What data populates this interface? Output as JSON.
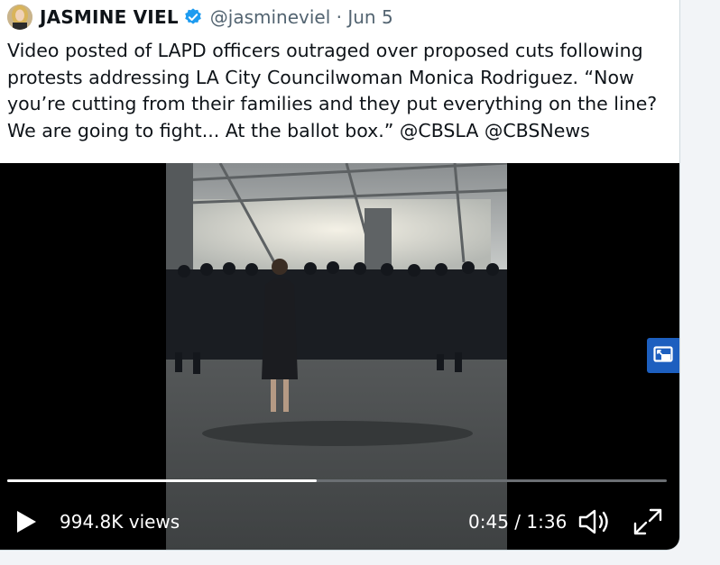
{
  "tweet": {
    "author_name": "JASMINE VIEL",
    "handle": "@jasmineviel",
    "separator": "·",
    "date": "Jun 5",
    "text": "Video posted of LAPD officers outraged over proposed cuts following protests addressing LA City Councilwoman Monica Rodriguez. “Now you’re cutting from their families and they put everything on the line? We are going to fight... At the ballot box.” @CBSLA @CBSNews"
  },
  "video": {
    "views": "994.8K views",
    "current_time": "0:45",
    "time_separator": "/",
    "duration": "1:36",
    "progress": 0.469
  },
  "icons": {
    "verified": "verified-badge-icon",
    "play": "play-icon",
    "volume": "volume-icon",
    "fullscreen": "fullscreen-icon",
    "pip": "picture-in-picture-icon"
  },
  "colors": {
    "verified_blue": "#1d9bf0",
    "pip_button": "#1d5fbf",
    "handle_gray": "#536471"
  }
}
